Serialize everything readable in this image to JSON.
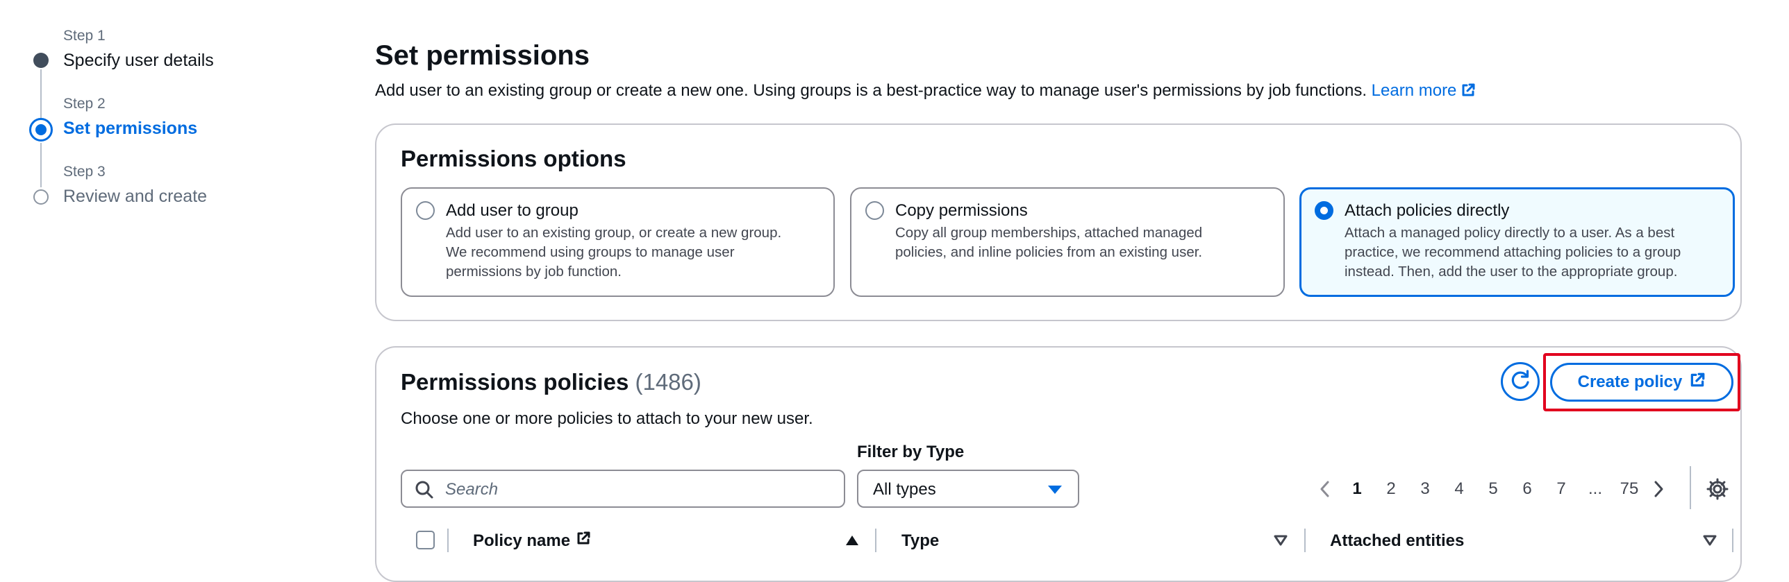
{
  "wizard": {
    "steps": [
      {
        "step_label": "Step 1",
        "title": "Specify user details"
      },
      {
        "step_label": "Step 2",
        "title": "Set permissions"
      },
      {
        "step_label": "Step 3",
        "title": "Review and create"
      }
    ],
    "active_step": 2
  },
  "page": {
    "title": "Set permissions",
    "description": "Add user to an existing group or create a new one. Using groups is a best-practice way to manage user's permissions by job functions.",
    "learn_more": "Learn more"
  },
  "permissions_options": {
    "title": "Permissions options",
    "options": [
      {
        "title": "Add user to group",
        "lines": [
          "Add user to an existing group, or create a new group.",
          "We recommend using groups to manage user",
          "permissions by job function."
        ],
        "selected": false
      },
      {
        "title": "Copy permissions",
        "lines": [
          "Copy all group memberships, attached managed",
          "policies, and inline policies from an existing user."
        ],
        "selected": false
      },
      {
        "title": "Attach policies directly",
        "lines": [
          "Attach a managed policy directly to a user. As a best",
          "practice, we recommend attaching policies to a group",
          "instead. Then, add the user to the appropriate group."
        ],
        "selected": true
      }
    ]
  },
  "policies": {
    "title": "Permissions policies",
    "count": "(1486)",
    "description": "Choose one or more policies to attach to your new user.",
    "create_policy": "Create policy",
    "search_placeholder": "Search",
    "filter_label": "Filter by Type",
    "filter_value": "All types",
    "pagination": {
      "pages": [
        "1",
        "2",
        "3",
        "4",
        "5",
        "6",
        "7",
        "...",
        "75"
      ],
      "current": "1"
    },
    "columns": {
      "policy_name": "Policy name",
      "type": "Type",
      "attached_entities": "Attached entities"
    }
  },
  "colors": {
    "accent": "#006ce0",
    "highlight": "#e1001e",
    "text": "#0f141a",
    "muted": "#5f6b7a"
  }
}
